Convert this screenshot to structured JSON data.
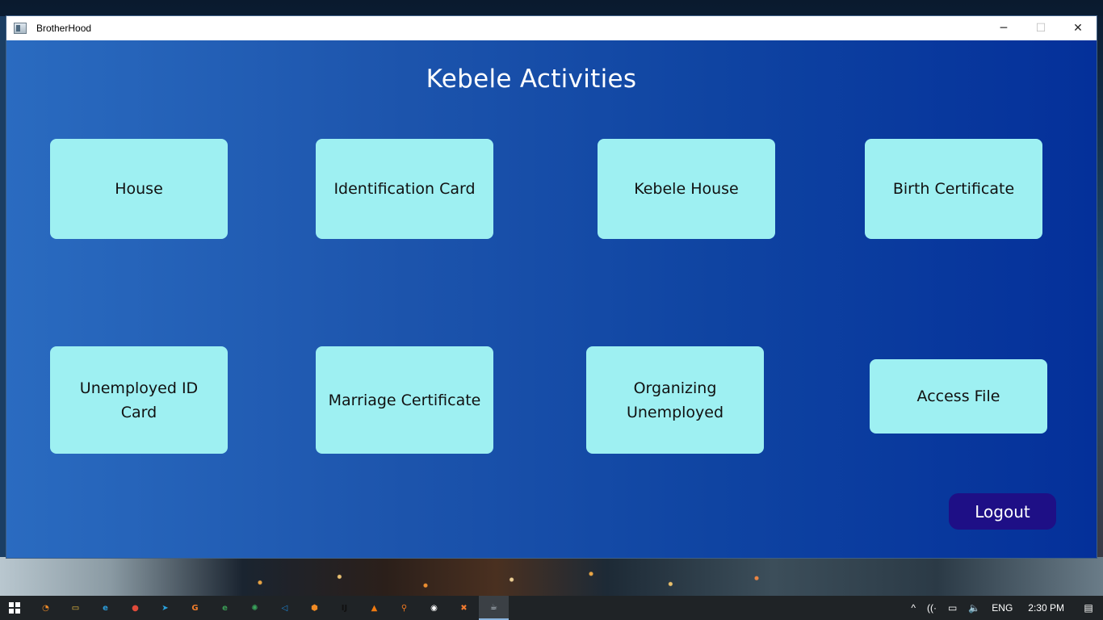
{
  "window": {
    "title": "BrotherHood",
    "controls": {
      "minimize": "─",
      "maximize": "☐",
      "close": "✕"
    }
  },
  "page": {
    "heading": "Kebele Activities"
  },
  "tiles": [
    {
      "label": "House"
    },
    {
      "label": "Identification Card"
    },
    {
      "label": "Kebele House"
    },
    {
      "label": "Birth Certificate"
    },
    {
      "label": "Unemployed ID Card"
    },
    {
      "label": "Marriage Certificate"
    },
    {
      "label": "Organizing\nUnemployed"
    },
    {
      "label": "Access File"
    }
  ],
  "logout_label": "Logout",
  "colors": {
    "tile_bg": "#9ef0f2",
    "logout_bg": "#1e0f86",
    "content_gradient_start": "#2a6bc0",
    "content_gradient_end": "#04309a"
  },
  "taskbar": {
    "apps": [
      {
        "name": "chrome-canary-icon",
        "glyph": "◔",
        "color": "#f28c28"
      },
      {
        "name": "file-explorer-icon",
        "glyph": "▭",
        "color": "#f0c040"
      },
      {
        "name": "edge-icon",
        "glyph": "e",
        "color": "#2b9bd8"
      },
      {
        "name": "chrome-icon",
        "glyph": "●",
        "color": "#e04a3a"
      },
      {
        "name": "telegram-icon",
        "glyph": "➤",
        "color": "#2aa3df"
      },
      {
        "name": "git-tool-icon",
        "glyph": "G",
        "color": "#f07c2a"
      },
      {
        "name": "edge-dev-icon",
        "glyph": "e",
        "color": "#3a9b55"
      },
      {
        "name": "network-app-icon",
        "glyph": "✺",
        "color": "#3aa55c"
      },
      {
        "name": "vscode-icon",
        "glyph": "◁",
        "color": "#1f88d8"
      },
      {
        "name": "settings-app-icon",
        "glyph": "⬢",
        "color": "#f08a24"
      },
      {
        "name": "intellij-icon",
        "glyph": "IJ",
        "color": "#111111"
      },
      {
        "name": "vlc-icon",
        "glyph": "▲",
        "color": "#f07a10"
      },
      {
        "name": "search-tool-icon",
        "glyph": "⚲",
        "color": "#f07820"
      },
      {
        "name": "obs-icon",
        "glyph": "◉",
        "color": "#ffffff"
      },
      {
        "name": "xampp-icon",
        "glyph": "✖",
        "color": "#f07a30"
      },
      {
        "name": "java-app-icon",
        "glyph": "☕",
        "color": "#c9d6e0"
      }
    ],
    "tray": {
      "chevron": "^",
      "wifi": "((·",
      "battery": "▭",
      "volume": "🔈",
      "language": "ENG",
      "time": "2:30 PM",
      "notifications": "▤"
    }
  }
}
